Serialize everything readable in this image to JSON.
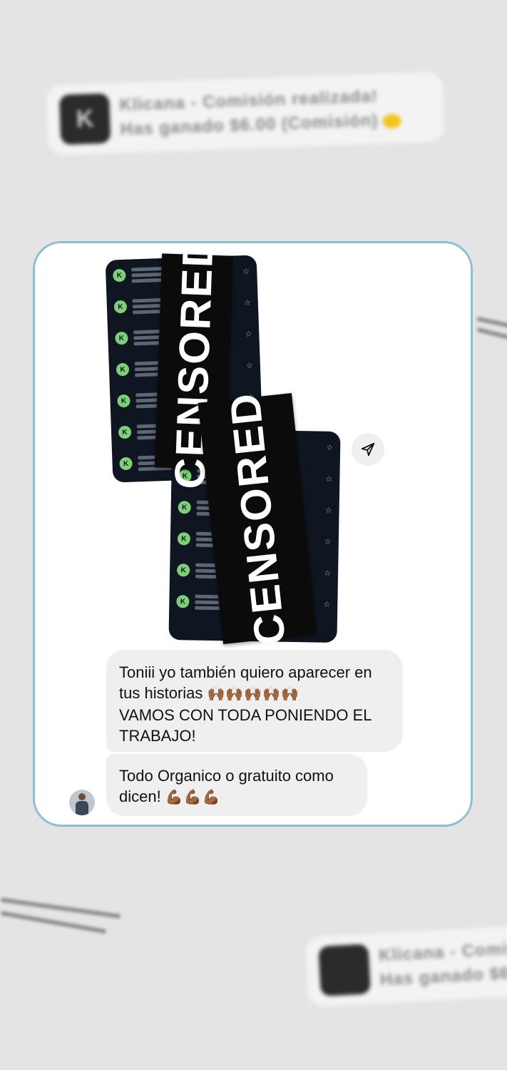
{
  "background_notification": {
    "line1": "Klicana - Comisión realizada!",
    "line2": "Has ganado $6.00 (Comisión)"
  },
  "screenshots": {
    "censor_label_1": "CENSORED",
    "censor_label_2": "CENSORED",
    "sender_initial": "K"
  },
  "messages": [
    {
      "line1": "Toniii yo también quiero aparecer en",
      "line2": "tus historias",
      "emoji": "🙌🏾🙌🏾🙌🏾🙌🏾🙌🏾",
      "line3": "VAMOS CON TODA PONIENDO EL",
      "line4": "TRABAJO!"
    },
    {
      "line1": "Todo Organico o gratuito como",
      "line2": "dicen!",
      "emoji": "💪🏾💪🏾💪🏾"
    }
  ],
  "icons": {
    "share": "send-icon",
    "avatar": "avatar"
  }
}
